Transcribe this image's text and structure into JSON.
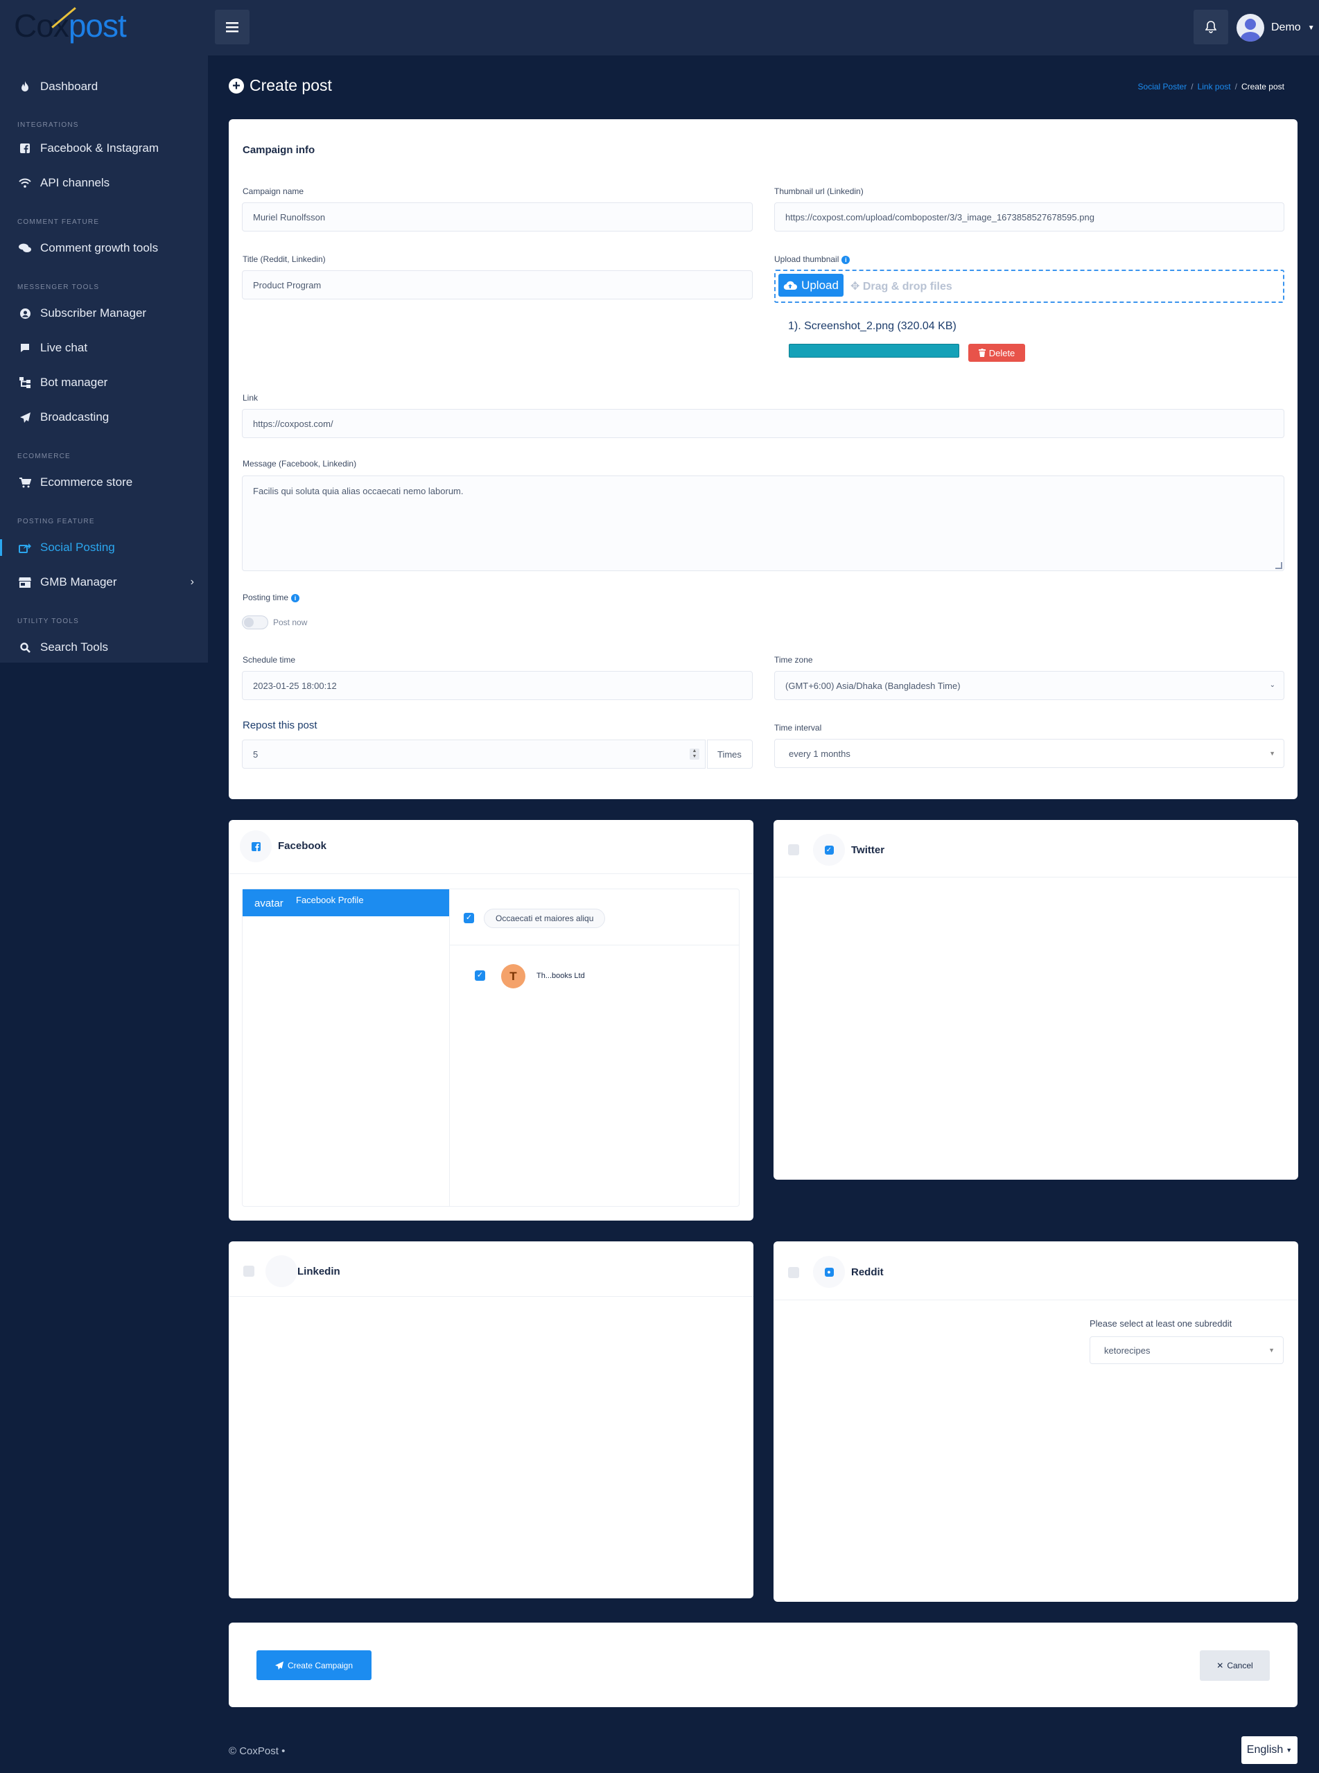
{
  "brand": {
    "logo_left": "Cox",
    "logo_right": "post"
  },
  "header": {
    "user_name": "Demo"
  },
  "sidebar": {
    "dashboard": "Dashboard",
    "sections": {
      "integrations": "INTEGRATIONS",
      "comment_feature": "COMMENT FEATURE",
      "messenger_tools": "MESSENGER TOOLS",
      "ecommerce": "ECOMMERCE",
      "posting_feature": "POSTING FEATURE",
      "utility_tools": "UTILITY TOOLS"
    },
    "items": {
      "facebook_instagram": "Facebook & Instagram",
      "api_channels": "API channels",
      "comment_growth_tools": "Comment growth tools",
      "subscriber_manager": "Subscriber Manager",
      "live_chat": "Live chat",
      "bot_manager": "Bot manager",
      "broadcasting": "Broadcasting",
      "ecommerce_store": "Ecommerce store",
      "social_posting": "Social Posting",
      "gmb_manager": "GMB Manager",
      "search_tools": "Search Tools"
    }
  },
  "page": {
    "title": "Create post",
    "breadcrumb": [
      "Social Poster",
      "Link post",
      "Create post"
    ]
  },
  "campaign": {
    "section_title": "Campaign info",
    "campaign_name_label": "Campaign name",
    "campaign_name_value": "Muriel Runolfsson",
    "thumbnail_url_label": "Thumbnail url (Linkedin)",
    "thumbnail_url_value": "https://coxpost.com/upload/comboposter/3/3_image_1673858527678595.png",
    "title_label": "Title (Reddit, Linkedin)",
    "title_value": "Product Program",
    "upload_thumbnail_label": "Upload thumbnail",
    "upload_button": "Upload",
    "drag_drop": "Drag & drop files",
    "file_name": "1). Screenshot_2.png (320.04 KB)",
    "upload_progress": 1.0,
    "delete_button": "Delete",
    "link_label": "Link",
    "link_value": "https://coxpost.com/",
    "message_label": "Message (Facebook, Linkedin)",
    "message_value": "Facilis qui soluta quia alias occaecati nemo laborum.",
    "posting_time_label": "Posting time",
    "post_now_label": "Post now",
    "schedule_time_label": "Schedule time",
    "schedule_time_value": "2023-01-25 18:00:12",
    "time_zone_label": "Time zone",
    "time_zone_value": "(GMT+6:00) Asia/Dhaka (Bangladesh Time)",
    "repost_label": "Repost this post",
    "repost_value": "5",
    "repost_suffix": "Times",
    "time_interval_label": "Time interval",
    "time_interval_value": "every 1 months"
  },
  "facebook": {
    "title": "Facebook",
    "profile_avatar_text": "avatar",
    "profile_label": "Facebook Profile",
    "group_chip": "Occaecati et maiores aliqu",
    "page_initial": "T",
    "page_name": "Th...books Ltd"
  },
  "twitter": {
    "title": "Twitter"
  },
  "linkedin": {
    "title": "Linkedin"
  },
  "reddit": {
    "title": "Reddit",
    "subreddit_label": "Please select at least one subreddit",
    "subreddit_value": "ketorecipes"
  },
  "actions": {
    "create": "Create Campaign",
    "cancel": "Cancel"
  },
  "footer": {
    "copyright": "© CoxPost  •",
    "language": "English"
  },
  "colors": {
    "accent": "#1c8cf0",
    "background": "#0f1f3d",
    "sidebar": "#1c2c4b",
    "danger": "#e8534a",
    "progress": "#15a1b8"
  }
}
